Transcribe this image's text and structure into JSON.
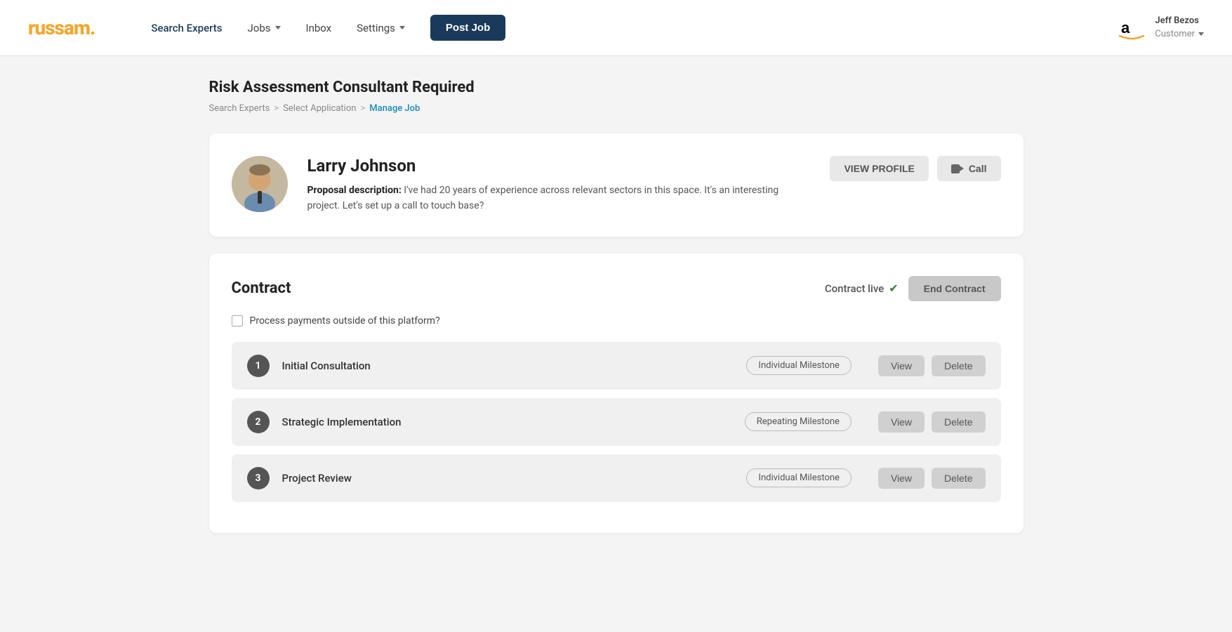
{
  "logo": {
    "text": "russam",
    "dot": "."
  },
  "nav": {
    "search_experts": "Search Experts",
    "jobs": "Jobs",
    "inbox": "Inbox",
    "settings": "Settings",
    "post_job": "Post Job"
  },
  "user": {
    "name": "Jeff Bezos",
    "role": "Customer"
  },
  "breadcrumb": {
    "search_experts": "Search Experts",
    "select_application": "Select Application",
    "manage_job": "Manage Job",
    "sep": ">"
  },
  "page": {
    "title": "Risk Assessment Consultant Required"
  },
  "expert": {
    "name": "Larry Johnson",
    "proposal_label": "Proposal description:",
    "proposal_text": "I've had 20 years of experience across relevant sectors in this space.  It's an interesting project.  Let's set up a call to touch base?",
    "view_profile_btn": "VIEW PROFILE",
    "call_btn": "Call"
  },
  "contract": {
    "title": "Contract",
    "status": "Contract live",
    "end_btn": "End Contract",
    "checkbox_label": "Process payments outside of this platform?",
    "milestones": [
      {
        "num": "1",
        "name": "Initial Consultation",
        "badge": "Individual Milestone",
        "view_btn": "View",
        "delete_btn": "Delete"
      },
      {
        "num": "2",
        "name": "Strategic Implementation",
        "badge": "Repeating Milestone",
        "view_btn": "View",
        "delete_btn": "Delete"
      },
      {
        "num": "3",
        "name": "Project Review",
        "badge": "Individual Milestone",
        "view_btn": "View",
        "delete_btn": "Delete"
      }
    ]
  }
}
